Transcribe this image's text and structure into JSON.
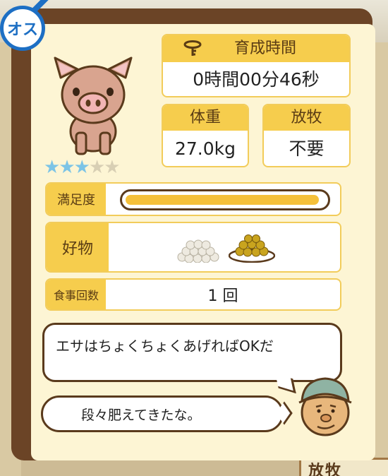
{
  "gender_badge": {
    "label": "オス",
    "icon": "male-symbol-icon"
  },
  "pig": {
    "icon": "pig-icon"
  },
  "rating": {
    "filled": 3,
    "total": 5
  },
  "growth": {
    "label": "育成時間",
    "value": "0時間00分46秒",
    "icon": "key-icon"
  },
  "weight": {
    "label": "体重",
    "value": "27.0kg"
  },
  "graze": {
    "label": "放牧",
    "value": "不要"
  },
  "satisfaction": {
    "label": "満足度",
    "level": 0.97
  },
  "likes": {
    "label": "好物",
    "items": [
      "rice-pile-icon",
      "bean-plate-icon"
    ]
  },
  "meals": {
    "label": "食事回数",
    "value": "1 回"
  },
  "dialogue": {
    "line1": "エサはちょくちょくあげればOKだ",
    "line2": "段々肥えてきたな。"
  },
  "background_sign": {
    "text": "放牧"
  },
  "colors": {
    "panel_border": "#6b4426",
    "panel_fill": "#fdf5d4",
    "header_yellow": "#f6cd4d",
    "star_on": "#7cc4e6",
    "star_off": "#d8cfb4",
    "gender_blue": "#1d6fc4"
  }
}
